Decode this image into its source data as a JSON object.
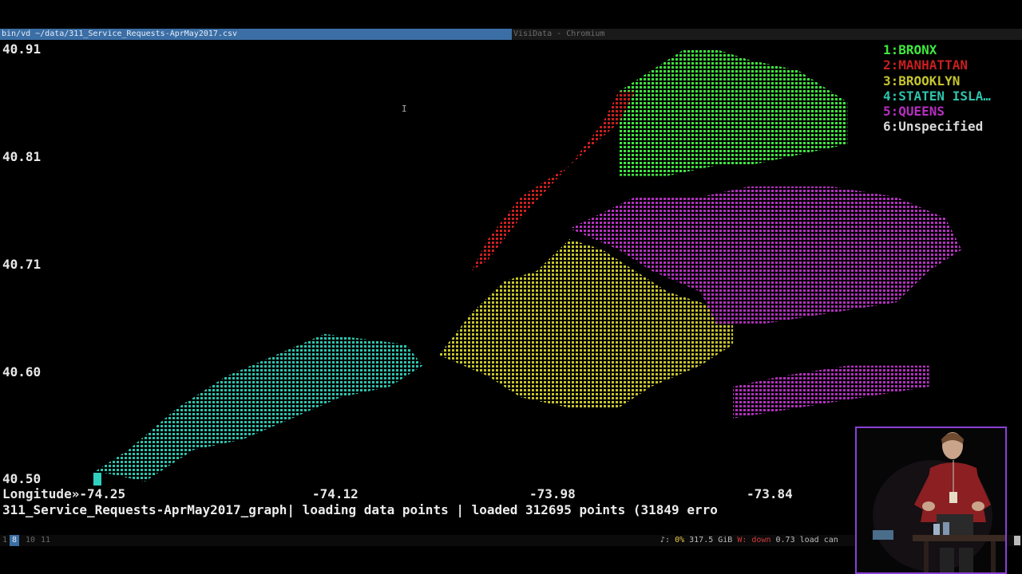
{
  "window": {
    "title": "bin/vd ~/data/311_Service_Requests-AprMay2017.csv",
    "other_title": "VisiData - Chromium"
  },
  "chart_data": {
    "type": "scatter",
    "xlabel": "Longitude",
    "x_ticks": [
      "Longitude»-74.25",
      "-74.12",
      "-73.98",
      "-73.84"
    ],
    "y_ticks": [
      "40.91",
      "40.81",
      "40.71",
      "40.60",
      "40.50"
    ],
    "xlim": [
      -74.25,
      -73.71
    ],
    "ylim": [
      40.5,
      40.91
    ],
    "legend_position": "top-right",
    "series": [
      {
        "name": "1:BRONX",
        "color": "#3ee83e",
        "regions": [
          {
            "x": [
              -73.93,
              -73.89,
              -73.87,
              -73.85,
              -73.82,
              -73.79,
              -73.79,
              -73.82,
              -73.85,
              -73.87,
              -73.9,
              -73.93,
              -73.93
            ],
            "y": [
              40.87,
              40.91,
              40.91,
              40.9,
              40.89,
              40.86,
              40.82,
              40.81,
              40.8,
              40.8,
              40.79,
              40.79,
              40.87
            ]
          }
        ]
      },
      {
        "name": "2:MANHATTAN",
        "color": "#c91f1f",
        "regions": [
          {
            "x": [
              -74.02,
              -74.01,
              -73.99,
              -73.96,
              -73.93,
              -73.92,
              -73.93,
              -73.94,
              -73.96,
              -73.99,
              -74.01,
              -74.02
            ],
            "y": [
              40.7,
              40.73,
              40.77,
              40.8,
              40.84,
              40.87,
              40.87,
              40.84,
              40.8,
              40.75,
              40.71,
              40.7
            ]
          }
        ]
      },
      {
        "name": "3:BROOKLYN",
        "color": "#c6c42e",
        "regions": [
          {
            "x": [
              -74.04,
              -74.02,
              -74.0,
              -73.98,
              -73.96,
              -73.94,
              -73.92,
              -73.9,
              -73.86,
              -73.86,
              -73.88,
              -73.91,
              -73.93,
              -73.96,
              -73.99,
              -74.01,
              -74.04
            ],
            "y": [
              40.62,
              40.66,
              40.69,
              40.7,
              40.73,
              40.72,
              40.7,
              40.68,
              40.66,
              40.63,
              40.61,
              40.59,
              40.57,
              40.57,
              40.58,
              40.6,
              40.62
            ]
          }
        ]
      },
      {
        "name": "4:STATEN ISLA…",
        "color": "#2ec4ad",
        "regions": [
          {
            "x": [
              -74.25,
              -74.23,
              -74.2,
              -74.17,
              -74.14,
              -74.11,
              -74.06,
              -74.05,
              -74.07,
              -74.1,
              -74.13,
              -74.16,
              -74.19,
              -74.22,
              -74.25
            ],
            "y": [
              40.51,
              40.53,
              40.57,
              40.6,
              40.62,
              40.64,
              40.63,
              40.61,
              40.59,
              40.58,
              40.56,
              40.54,
              40.53,
              40.5,
              40.51
            ]
          }
        ]
      },
      {
        "name": "5:QUEENS",
        "color": "#b42fbf",
        "regions": [
          {
            "x": [
              -73.96,
              -73.92,
              -73.88,
              -73.85,
              -73.8,
              -73.76,
              -73.73,
              -73.72,
              -73.74,
              -73.76,
              -73.8,
              -73.84,
              -73.87,
              -73.88,
              -73.91,
              -73.93,
              -73.96
            ],
            "y": [
              40.74,
              40.77,
              40.77,
              40.78,
              40.78,
              40.77,
              40.75,
              40.72,
              40.7,
              40.67,
              40.66,
              40.65,
              40.65,
              40.68,
              40.7,
              40.72,
              40.74
            ]
          },
          {
            "x": [
              -73.86,
              -73.83,
              -73.79,
              -73.74,
              -73.74,
              -73.78,
              -73.82,
              -73.86,
              -73.86
            ],
            "y": [
              40.59,
              40.6,
              40.61,
              40.61,
              40.59,
              40.58,
              40.57,
              40.56,
              40.59
            ]
          }
        ]
      },
      {
        "name": "6:Unspecified",
        "color": "#d9d9d9",
        "regions": []
      }
    ]
  },
  "status_line": {
    "sheet": "311_Service_Requests-AprMay2017_graph|",
    "message": " loading data points | loaded 312695 points (31849 erro"
  },
  "tmux": {
    "windows": [
      "1",
      "8",
      "10",
      "11"
    ],
    "active_window": "8",
    "right_prefix": "♪: ",
    "cpu_pct": "0%",
    "mem": " 317.5 GiB ",
    "wifi": "W: ",
    "down": "down",
    "load": " 0.73 load ",
    "tail": "can"
  },
  "video": {
    "border_color": "#8b3fd6"
  }
}
